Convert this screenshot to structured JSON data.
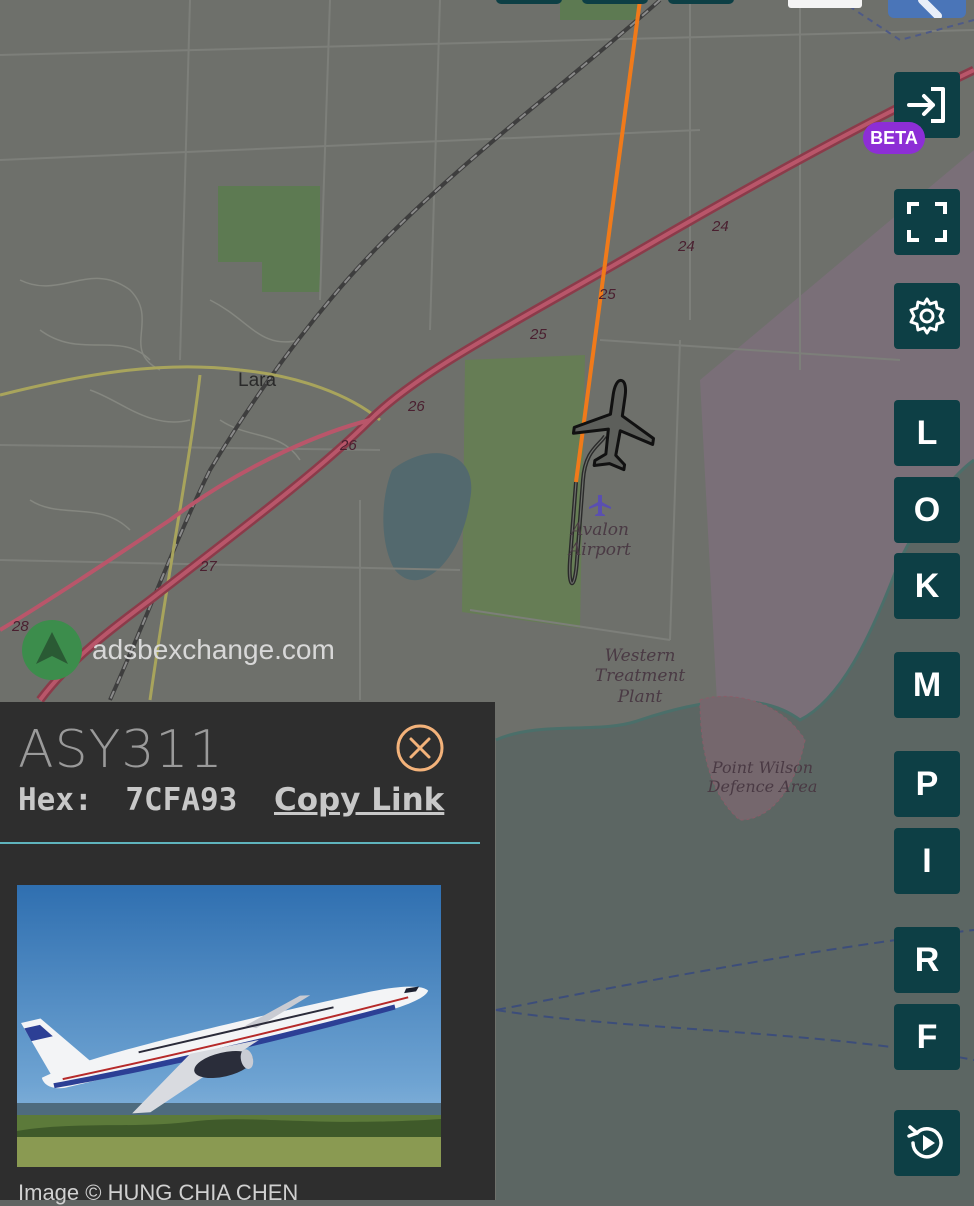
{
  "map": {
    "town_label": "Lara",
    "airport_label": "Avalon Airport",
    "poi_labels": [
      "Western Treatment Plant",
      "Point Wilson Defence Area"
    ],
    "road_numbers": [
      "24",
      "24",
      "25",
      "25",
      "26",
      "26",
      "27",
      "28"
    ],
    "watermark": "adsbexchange.com",
    "colors": {
      "track": "#f07a1a",
      "track_ground": "#2e2e2e",
      "sea": "#5d6764",
      "land": "#6f716c"
    }
  },
  "toolbar": {
    "beta_badge": "BETA",
    "letter_buttons": [
      "L",
      "O",
      "K",
      "M",
      "P",
      "I",
      "R",
      "F"
    ]
  },
  "aircraft": {
    "callsign": "ASY311",
    "hex_label": "Hex:",
    "hex_value": "7CFA93",
    "copy_link_label": "Copy Link",
    "photo_credit": "Image © HUNG CHIA CHEN"
  }
}
